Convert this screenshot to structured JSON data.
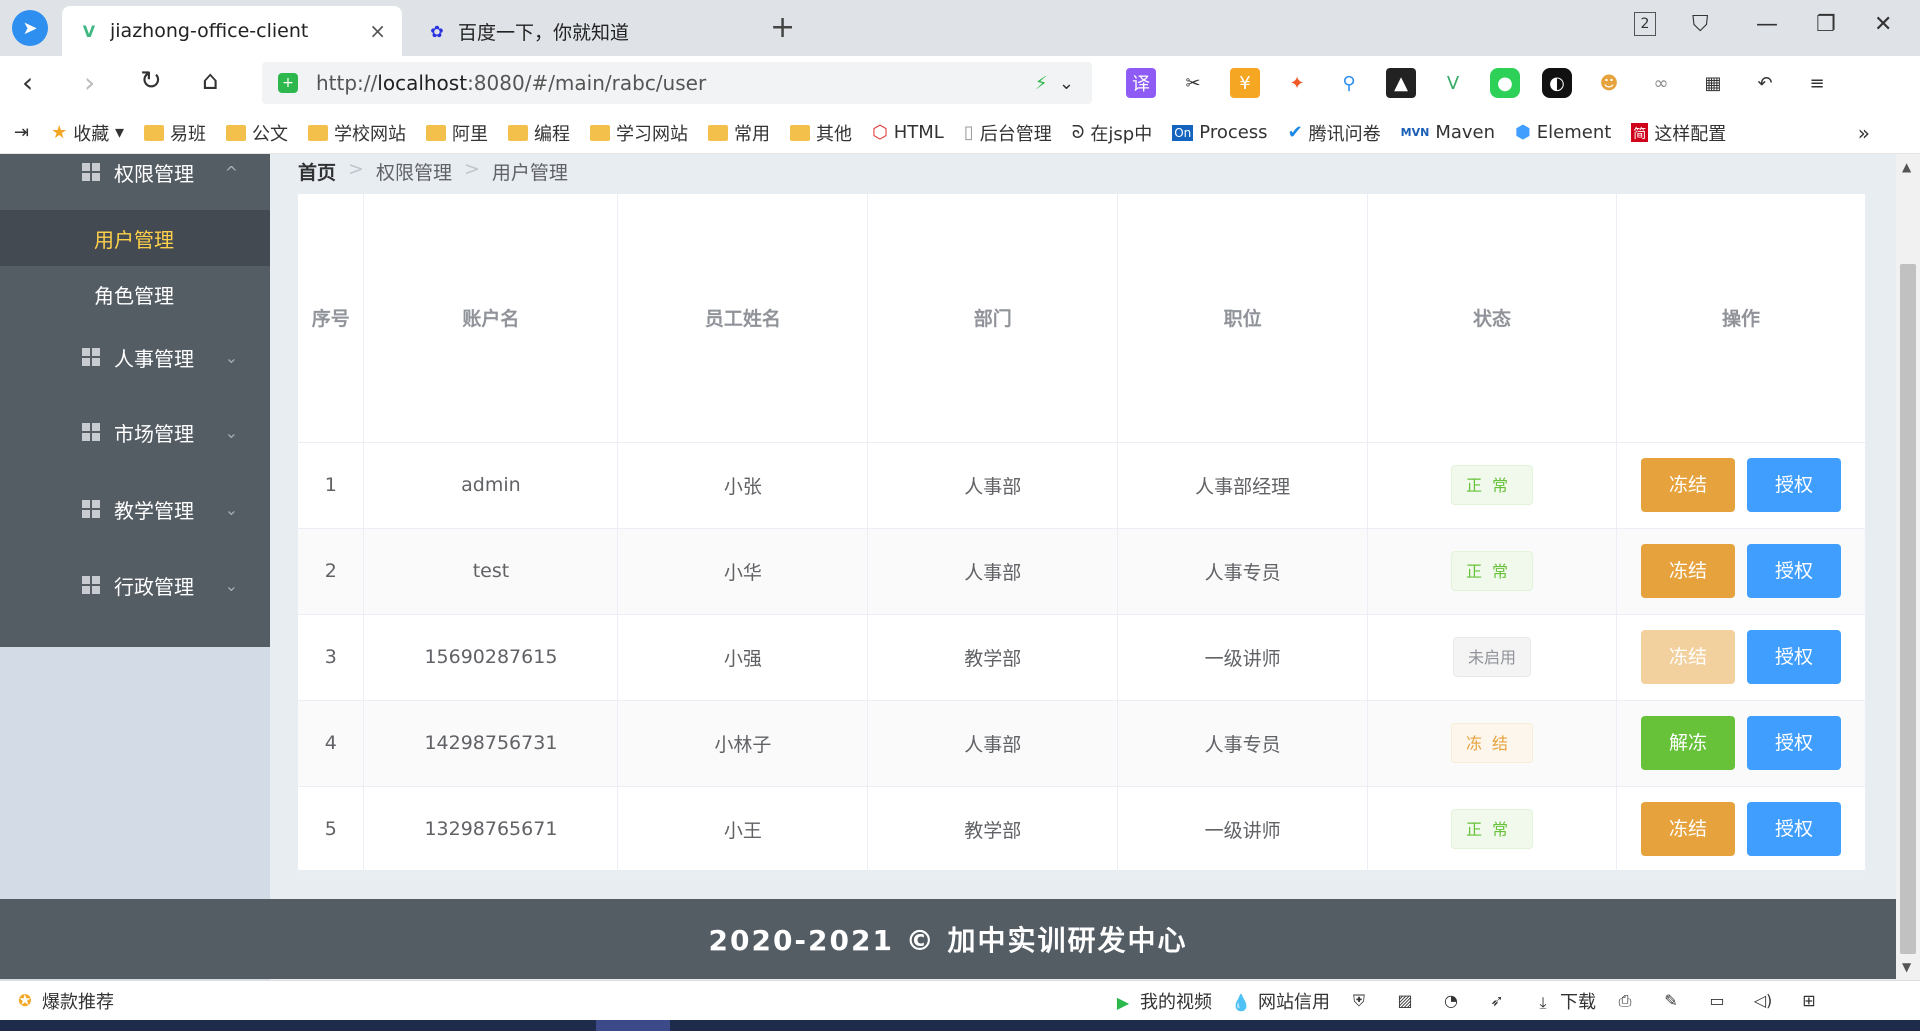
{
  "browser": {
    "tabs": [
      {
        "title": "jiazhong-office-client",
        "close": "×",
        "favicon": "vue-logo-icon",
        "active": true
      },
      {
        "title": "百度一下，你就知道",
        "favicon": "baidu-paw-icon",
        "active": false
      }
    ],
    "new_tab": "+",
    "tab_count": "2",
    "url": {
      "scheme": "http://",
      "host": "localhost",
      "rest": ":8080/#/main/rabc/user"
    },
    "bookmarks": [
      {
        "label": "收藏",
        "icon": "star-icon"
      },
      {
        "label": "易班",
        "icon": "folder-icon"
      },
      {
        "label": "公文",
        "icon": "folder-icon"
      },
      {
        "label": "学校网站",
        "icon": "folder-icon"
      },
      {
        "label": "阿里",
        "icon": "folder-icon"
      },
      {
        "label": "编程",
        "icon": "folder-icon"
      },
      {
        "label": "学习网站",
        "icon": "folder-icon"
      },
      {
        "label": "常用",
        "icon": "folder-icon"
      },
      {
        "label": "其他",
        "icon": "folder-icon"
      },
      {
        "label": "HTML",
        "icon": "html-icon"
      },
      {
        "label": "后台管理",
        "icon": "page-icon"
      },
      {
        "label": "在jsp中",
        "icon": "link-icon"
      },
      {
        "label": "Process",
        "icon": "on-icon"
      },
      {
        "label": "腾讯问卷",
        "icon": "check-icon"
      },
      {
        "label": "Maven",
        "icon": "maven-icon"
      },
      {
        "label": "Element",
        "icon": "element-icon"
      },
      {
        "label": "这样配置",
        "icon": "jian-icon"
      }
    ],
    "bookmarks_more": "»"
  },
  "sidebar": {
    "groups": [
      {
        "label": "权限管理",
        "chevron": "^",
        "expanded": true
      },
      {
        "label": "人事管理",
        "chevron": "⌄"
      },
      {
        "label": "市场管理",
        "chevron": "⌄"
      },
      {
        "label": "教学管理",
        "chevron": "⌄"
      },
      {
        "label": "行政管理",
        "chevron": "⌄"
      }
    ],
    "subitems": [
      {
        "label": "用户管理",
        "active": true
      },
      {
        "label": "角色管理",
        "active": false
      }
    ]
  },
  "breadcrumb": {
    "home": "首页",
    "level1": "权限管理",
    "level2": "用户管理",
    "separator": ">"
  },
  "table": {
    "columns": [
      "序号",
      "账户名",
      "员工姓名",
      "部门",
      "职位",
      "状态",
      "操作"
    ],
    "rows": [
      {
        "index": "1",
        "account": "admin",
        "name": "小张",
        "dept": "人事部",
        "position": "人事部经理",
        "status": "正常",
        "status_type": "normal",
        "action1": "冻结",
        "action1_type": "freeze",
        "action2": "授权"
      },
      {
        "index": "2",
        "account": "test",
        "name": "小华",
        "dept": "人事部",
        "position": "人事专员",
        "status": "正常",
        "status_type": "normal",
        "action1": "冻结",
        "action1_type": "freeze",
        "action2": "授权"
      },
      {
        "index": "3",
        "account": "15690287615",
        "name": "小强",
        "dept": "教学部",
        "position": "一级讲师",
        "status": "未启用",
        "status_type": "disabled",
        "action1": "冻结",
        "action1_type": "freeze off",
        "action2": "授权"
      },
      {
        "index": "4",
        "account": "14298756731",
        "name": "小林子",
        "dept": "人事部",
        "position": "人事专员",
        "status": "冻结",
        "status_type": "frozen",
        "action1": "解冻",
        "action1_type": "unfreeze",
        "action2": "授权"
      },
      {
        "index": "5",
        "account": "13298765671",
        "name": "小王",
        "dept": "教学部",
        "position": "一级讲师",
        "status": "正常",
        "status_type": "normal",
        "action1": "冻结",
        "action1_type": "freeze",
        "action2": "授权"
      }
    ]
  },
  "footer": {
    "text": "2020-2021 © 加中实训研发中心"
  },
  "statusbar": {
    "left": "爆款推荐",
    "items": [
      {
        "label": "我的视频",
        "icon": "video-icon"
      },
      {
        "label": "网站信用",
        "icon": "credit-icon"
      },
      {
        "label": "下载",
        "icon": "download-icon"
      }
    ]
  },
  "colors": {
    "sidebar_bg": "#545c64",
    "active_menu_text": "#ffd04b",
    "primary": "#409eff",
    "warning": "#e6a23c",
    "success": "#67c23a"
  }
}
